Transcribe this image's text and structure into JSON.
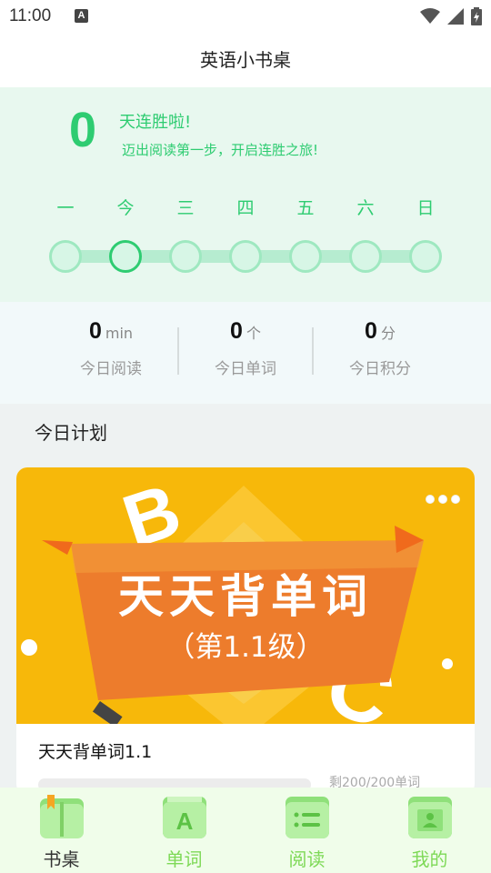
{
  "status_bar": {
    "time": "11:00",
    "notification_glyph": "A"
  },
  "app_bar": {
    "title": "英语小书桌"
  },
  "streak": {
    "count": "0",
    "title": "天连胜啦!",
    "subtitle": "迈出阅读第一步，开启连胜之旅!",
    "weekdays": [
      "一",
      "今",
      "三",
      "四",
      "五",
      "六",
      "日"
    ],
    "today_index": 1
  },
  "stats": [
    {
      "value": "0",
      "unit": "min",
      "label": "今日阅读"
    },
    {
      "value": "0",
      "unit": "个",
      "label": "今日单词"
    },
    {
      "value": "0",
      "unit": "分",
      "label": "今日积分"
    }
  ],
  "plan": {
    "section_title": "今日计划",
    "card": {
      "banner_title": "天天背单词",
      "banner_subtitle": "（第1.1级）",
      "title": "天天背单词1.1",
      "remaining": "剩200/200单词",
      "progress": 0
    }
  },
  "colors": {
    "accent": "#2ecc71",
    "tab_inactive": "#7ed957",
    "banner": "#f7b80a"
  },
  "tabs": [
    {
      "label": "书桌",
      "icon": "book-icon",
      "active": true
    },
    {
      "label": "单词",
      "icon": "letter-a-icon",
      "active": false
    },
    {
      "label": "阅读",
      "icon": "list-icon",
      "active": false
    },
    {
      "label": "我的",
      "icon": "profile-card-icon",
      "active": false
    }
  ]
}
